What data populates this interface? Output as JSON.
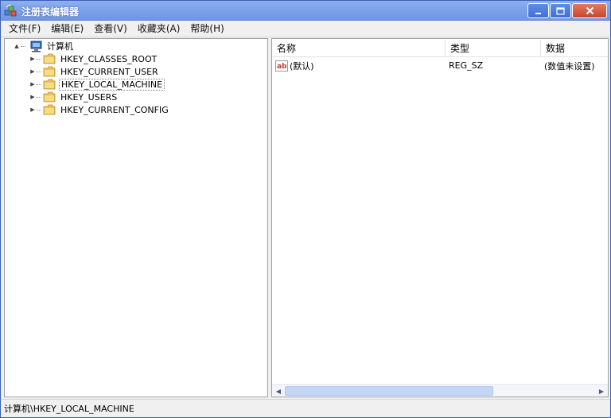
{
  "window": {
    "title": "注册表编辑器",
    "icon": "registry-editor-icon",
    "controls": {
      "minimize": "minimize-icon",
      "maximize": "maximize-icon",
      "close": "close-icon"
    }
  },
  "menu": [
    "文件(F)",
    "编辑(E)",
    "查看(V)",
    "收藏夹(A)",
    "帮助(H)"
  ],
  "tree": {
    "root": {
      "label": "计算机",
      "expander": "▲",
      "icon": "computer-icon"
    },
    "children": [
      {
        "label": "HKEY_CLASSES_ROOT",
        "expander": "▶"
      },
      {
        "label": "HKEY_CURRENT_USER",
        "expander": "▶"
      },
      {
        "label": "HKEY_LOCAL_MACHINE",
        "expander": "▶",
        "selected": true
      },
      {
        "label": "HKEY_USERS",
        "expander": "▶"
      },
      {
        "label": "HKEY_CURRENT_CONFIG",
        "expander": "▶"
      }
    ]
  },
  "list": {
    "columns": [
      "名称",
      "类型",
      "数据"
    ],
    "rows": [
      {
        "icon": "string-value-icon",
        "name": "(默认)",
        "type": "REG_SZ",
        "data": "(数值未设置)"
      }
    ]
  },
  "scrollbar": {
    "left_arrow": "◀",
    "right_arrow": "▶"
  },
  "status": "计算机\\HKEY_LOCAL_MACHINE",
  "colors": {
    "title_bar": "#7ea3ea",
    "close_button": "#c8452c",
    "folder": "#e8c45a",
    "scroll_thumb": "#c4d6f7"
  }
}
